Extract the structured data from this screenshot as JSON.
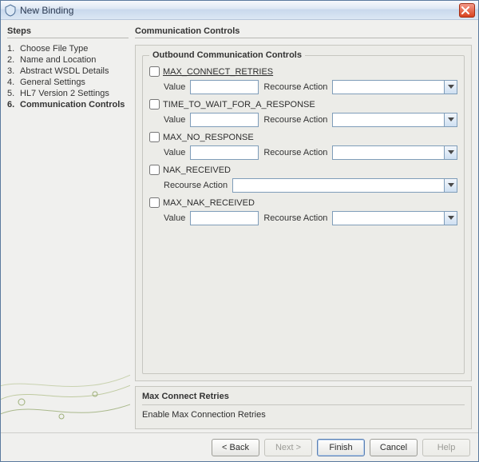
{
  "window": {
    "title": "New Binding"
  },
  "steps": {
    "title": "Steps",
    "items": [
      {
        "num": "1.",
        "label": "Choose File Type"
      },
      {
        "num": "2.",
        "label": "Name and Location"
      },
      {
        "num": "3.",
        "label": "Abstract WSDL Details"
      },
      {
        "num": "4.",
        "label": "General Settings"
      },
      {
        "num": "5.",
        "label": "HL7 Version 2 Settings"
      },
      {
        "num": "6.",
        "label": "Communication Controls"
      }
    ],
    "active_index": 5
  },
  "panel": {
    "title": "Communication Controls",
    "group_legend": "Outbound Communication Controls",
    "value_label": "Value",
    "recourse_label": "Recourse Action",
    "options": {
      "max_connect_retries": {
        "label": "MAX_CONNECT_RETRIES",
        "checked": false,
        "value": "",
        "recourse": ""
      },
      "time_to_wait": {
        "label": "TIME_TO_WAIT_FOR_A_RESPONSE",
        "checked": false,
        "value": "",
        "recourse": ""
      },
      "max_no_response": {
        "label": "MAX_NO_RESPONSE",
        "checked": false,
        "value": "",
        "recourse": ""
      },
      "nak_received": {
        "label": "NAK_RECEIVED",
        "checked": false,
        "recourse": ""
      },
      "max_nak_received": {
        "label": "MAX_NAK_RECEIVED",
        "checked": false,
        "value": "",
        "recourse": ""
      }
    }
  },
  "help": {
    "title": "Max Connect Retries",
    "text": "Enable Max Connection Retries"
  },
  "buttons": {
    "back": "< Back",
    "next": "Next >",
    "finish": "Finish",
    "cancel": "Cancel",
    "help": "Help"
  }
}
